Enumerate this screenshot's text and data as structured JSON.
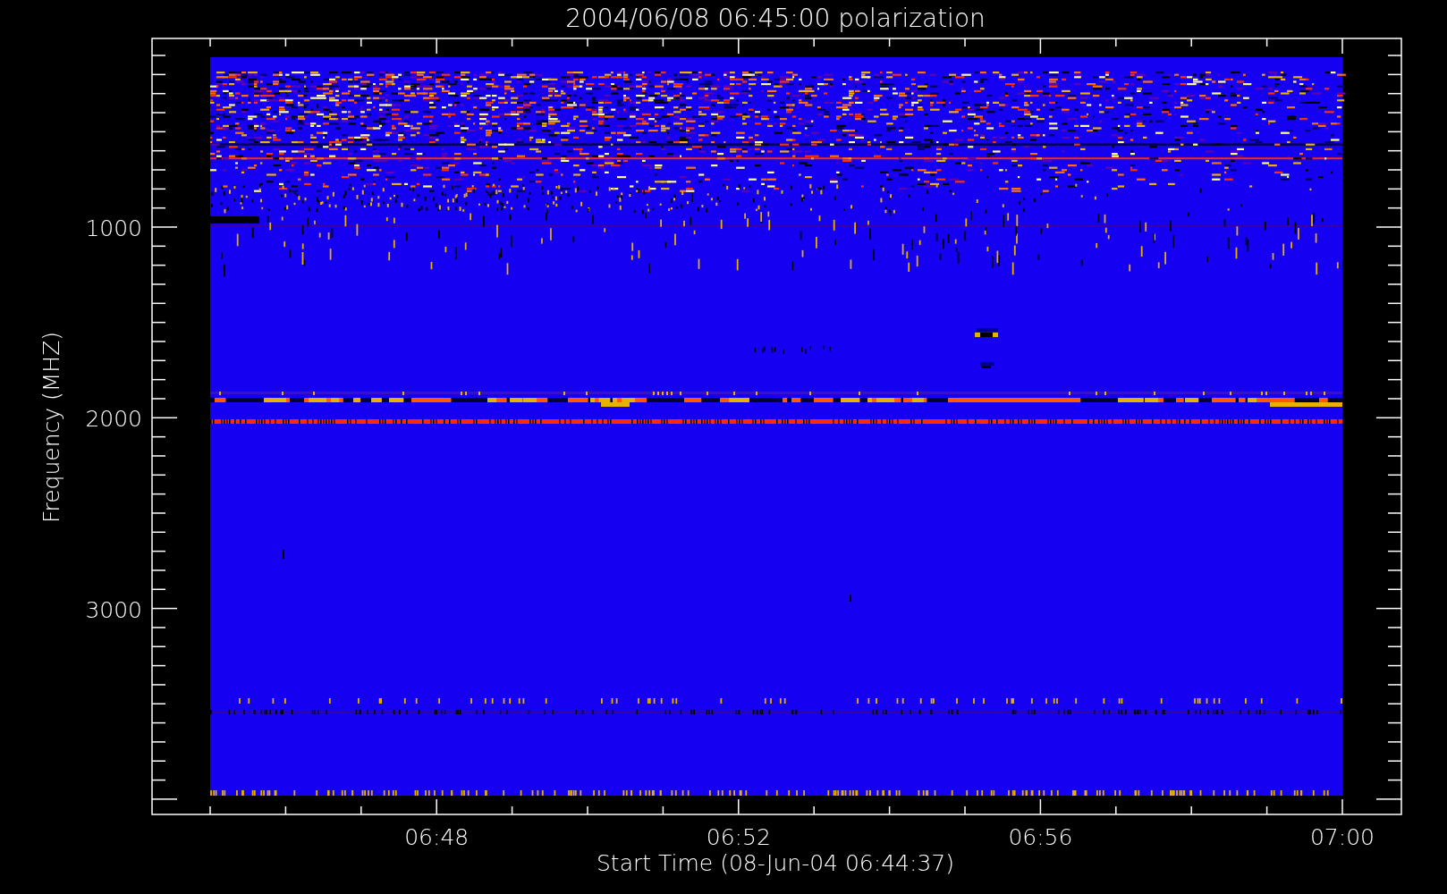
{
  "plot": {
    "title": "2004/06/08 06:45:00 polarization",
    "xlabel": "Start Time (08-Jun-04 06:44:37)",
    "ylabel": "Frequency (MHZ)",
    "xtick_labels": [
      "06:48",
      "06:52",
      "06:56",
      "07:00"
    ],
    "ytick_labels": [
      "1000",
      "2000",
      "3000"
    ]
  }
}
